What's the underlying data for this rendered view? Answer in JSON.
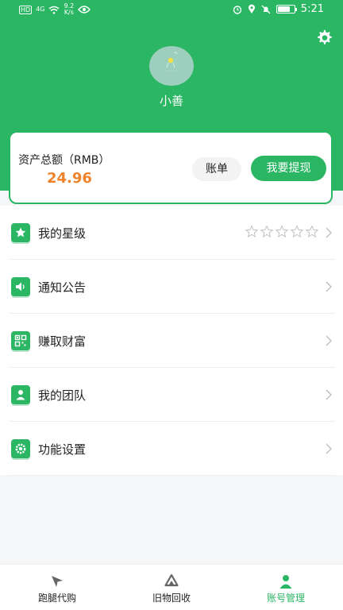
{
  "statusbar": {
    "hd_badge": "HD",
    "net_type": "4G",
    "speed_value": "9.2",
    "speed_unit": "K/s",
    "time": "5:21"
  },
  "colors": {
    "accent": "#2bb664",
    "balance": "#f0822a"
  },
  "user": {
    "name": "小善"
  },
  "balance": {
    "label": "资产总额（RMB）",
    "value": "24.96",
    "bill_button": "账单",
    "withdraw_button": "我要提现"
  },
  "menu": [
    {
      "label": "我的星级",
      "icon": "star-badge-icon",
      "stars": 5
    },
    {
      "label": "通知公告",
      "icon": "speaker-icon"
    },
    {
      "label": "赚取财富",
      "icon": "qr-code-icon"
    },
    {
      "label": "我的团队",
      "icon": "person-icon"
    },
    {
      "label": "功能设置",
      "icon": "gear-icon"
    }
  ],
  "tabs": [
    {
      "label": "跑腿代购",
      "icon": "send-arrow-icon",
      "active": false
    },
    {
      "label": "旧物回收",
      "icon": "recycle-icon",
      "active": false
    },
    {
      "label": "账号管理",
      "icon": "account-icon",
      "active": true
    }
  ]
}
